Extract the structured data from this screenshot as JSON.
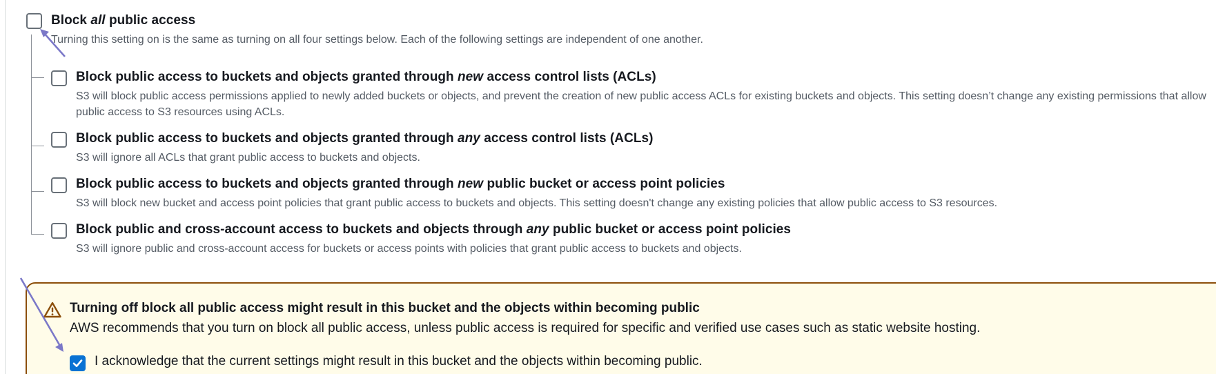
{
  "block_all": {
    "title_prefix": "Block ",
    "title_emph": "all",
    "title_suffix": " public access",
    "description": "Turning this setting on is the same as turning on all four settings below. Each of the following settings are independent of one another.",
    "checked": false
  },
  "settings": [
    {
      "title_prefix": "Block public access to buckets and objects granted through ",
      "title_emph": "new",
      "title_suffix": " access control lists (ACLs)",
      "description": "S3 will block public access permissions applied to newly added buckets or objects, and prevent the creation of new public access ACLs for existing buckets and objects. This setting doesn’t change any existing permissions that allow public access to S3 resources using ACLs.",
      "checked": false
    },
    {
      "title_prefix": "Block public access to buckets and objects granted through ",
      "title_emph": "any",
      "title_suffix": " access control lists (ACLs)",
      "description": "S3 will ignore all ACLs that grant public access to buckets and objects.",
      "checked": false
    },
    {
      "title_prefix": "Block public access to buckets and objects granted through ",
      "title_emph": "new",
      "title_suffix": " public bucket or access point policies",
      "description": "S3 will block new bucket and access point policies that grant public access to buckets and objects. This setting doesn't change any existing policies that allow public access to S3 resources.",
      "checked": false
    },
    {
      "title_prefix": "Block public and cross-account access to buckets and objects through ",
      "title_emph": "any",
      "title_suffix": " public bucket or access point policies",
      "description": "S3 will ignore public and cross-account access for buckets or access points with policies that grant public access to buckets and objects.",
      "checked": false
    }
  ],
  "warning": {
    "icon": "warning-triangle-icon",
    "title": "Turning off block all public access might result in this bucket and the objects within becoming public",
    "body": "AWS recommends that you turn on block all public access, unless public access is required for specific and verified use cases such as static website hosting.",
    "acknowledge_label": "I acknowledge that the current settings might result in this bucket and the objects within becoming public.",
    "acknowledge_checked": true
  },
  "colors": {
    "primary_blue": "#0972d3",
    "warning_border": "#8c4f0b",
    "warning_bg": "#fffce9",
    "annotation_arrow": "#7b78c8"
  }
}
